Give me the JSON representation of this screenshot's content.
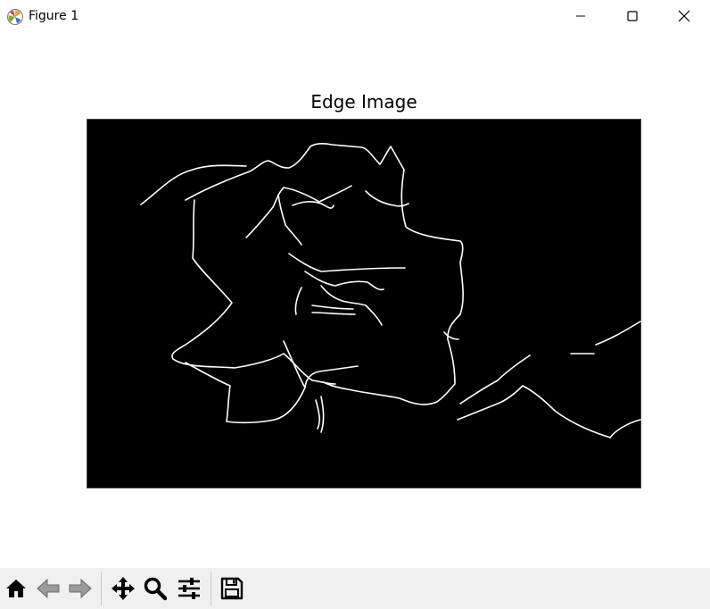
{
  "window": {
    "title": "Figure 1",
    "icons": {
      "app": "matplotlib-icon",
      "minimize": "minimize-icon",
      "maximize": "maximize-icon",
      "close": "close-icon"
    }
  },
  "figure": {
    "title": "Edge Image",
    "image": {
      "background": "#000000",
      "edge_color": "#ffffff"
    }
  },
  "toolbar": {
    "buttons": [
      {
        "name": "home",
        "icon": "home-icon"
      },
      {
        "name": "back",
        "icon": "back-arrow-icon"
      },
      {
        "name": "forward",
        "icon": "forward-arrow-icon"
      },
      {
        "name": "pan",
        "icon": "move-icon"
      },
      {
        "name": "zoom",
        "icon": "magnifier-icon"
      },
      {
        "name": "configure-subplots",
        "icon": "sliders-icon"
      },
      {
        "name": "save",
        "icon": "floppy-disk-icon"
      }
    ]
  }
}
